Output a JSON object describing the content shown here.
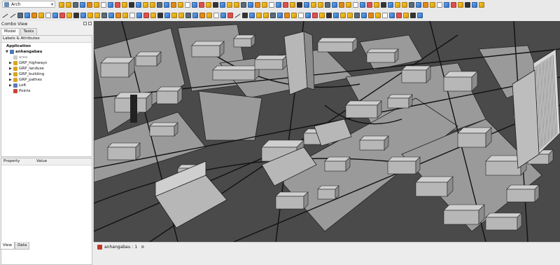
{
  "toolbar": {
    "workbench_label": "Arch",
    "workbench_icon": "arch-workbench-icon",
    "row1_icons": [
      "new-file-icon",
      "open-icon",
      "save-icon",
      "print-icon",
      "cut-icon",
      "copy-icon",
      "paste-icon",
      "undo-icon",
      "redo-icon",
      "refresh-icon",
      "macro-icon",
      "help-icon",
      "wall-icon",
      "structure-icon",
      "window-icon",
      "roof-icon",
      "stairs-icon",
      "space-icon",
      "section-icon",
      "axis-icon",
      "site-icon",
      "building-icon",
      "floor-icon",
      "panel-icon",
      "frame-icon",
      "pipe-icon",
      "equipment-icon",
      "fence-icon",
      "truss-icon",
      "profile-icon",
      "rebar-icon",
      "material-icon",
      "schedule-icon",
      "survey-icon",
      "ifc-icon",
      "check-icon",
      "split-icon",
      "mesh-icon",
      "select-icon",
      "close-holes-icon",
      "merge-icon",
      "remove-icon",
      "add-icon",
      "measure-icon",
      "visibility-icon",
      "camera-icon",
      "zoom-icon",
      "fit-all-icon",
      "front-view-icon",
      "top-view-icon",
      "right-view-icon",
      "rear-view-icon",
      "bottom-view-icon",
      "left-view-icon",
      "isometric-icon",
      "part-icon",
      "box-icon",
      "draw-style-icon",
      "stereo-icon",
      "std-views-icon",
      "measure-distance-icon"
    ],
    "row2_icons": [
      "line-icon",
      "wire-icon",
      "fillet-icon",
      "arc-icon",
      "circle-icon",
      "ellipse-icon",
      "rectangle-icon",
      "polygon-icon",
      "bspline-icon",
      "bezier-icon",
      "point-icon",
      "facebinder-icon",
      "shapestring-icon",
      "dimension-icon",
      "label-icon",
      "text-icon",
      "move-icon",
      "rotate-icon",
      "offset-icon",
      "trim-icon",
      "upgrade-icon",
      "downgrade-icon",
      "scale-icon",
      "edit-icon",
      "join-icon",
      "split-icon",
      "array-icon",
      "polar-array-icon",
      "path-array-icon",
      "clone-icon",
      "mirror-icon",
      "stretch-icon",
      "drawing-icon",
      "wire-to-bspline-icon",
      "shape2d-icon",
      "snap-icon",
      "working-plane-icon",
      "grid-icon",
      "lock-icon",
      "perpendicular-icon",
      "parallel-icon",
      "angle-icon",
      "center-icon",
      "near-icon",
      "extension-icon",
      "ortho-icon",
      "special-icon",
      "intersection-icon",
      "dimension-snap-icon",
      "midpoint-icon",
      "endpoint-icon",
      "construction-icon",
      "layer-icon",
      "group-icon",
      "autogroup-icon",
      "apply-style-icon",
      "toggle-mode-icon",
      "selection-icon",
      "shape-info-icon",
      "record-icon"
    ]
  },
  "combo_view": {
    "title": "Combo View",
    "tabs": [
      "Model",
      "Tasks"
    ],
    "active_tab": "Model",
    "tree_header": "Labels & Attributes",
    "tree": [
      {
        "label": "Application",
        "icon": "",
        "level": 0,
        "arrow": ""
      },
      {
        "label": "anhangabau",
        "icon": "document-icon",
        "level": 1,
        "arrow": "▼"
      },
      {
        "label": "area",
        "icon": "area-icon",
        "level": 2,
        "arrow": ""
      },
      {
        "label": "GRP_highways",
        "icon": "group-icon",
        "level": 2,
        "arrow": "▶"
      },
      {
        "label": "GRP_landuse",
        "icon": "group-icon",
        "level": 2,
        "arrow": "▶"
      },
      {
        "label": "GRP_building",
        "icon": "group-icon",
        "level": 2,
        "arrow": "▶"
      },
      {
        "label": "GRP_pathes",
        "icon": "group-icon",
        "level": 2,
        "arrow": "▶"
      },
      {
        "label": "Loft",
        "icon": "loft-icon",
        "level": 2,
        "arrow": "▶"
      },
      {
        "label": "Points",
        "icon": "points-icon",
        "level": 2,
        "arrow": ""
      }
    ],
    "properties_columns": [
      "Property",
      "Value"
    ],
    "bottom_tabs": [
      "View",
      "Data"
    ],
    "active_bottom_tab": "View"
  },
  "document_tab": {
    "label": "anhangabau : 1",
    "icon": "freecad-document-icon",
    "close_icon": "close-icon"
  },
  "colors": {
    "viewport_bg": "#4a4a4a",
    "building_fill": "#b7b7b7",
    "building_shade": "#8c8c8c",
    "road_stroke": "#111111"
  }
}
